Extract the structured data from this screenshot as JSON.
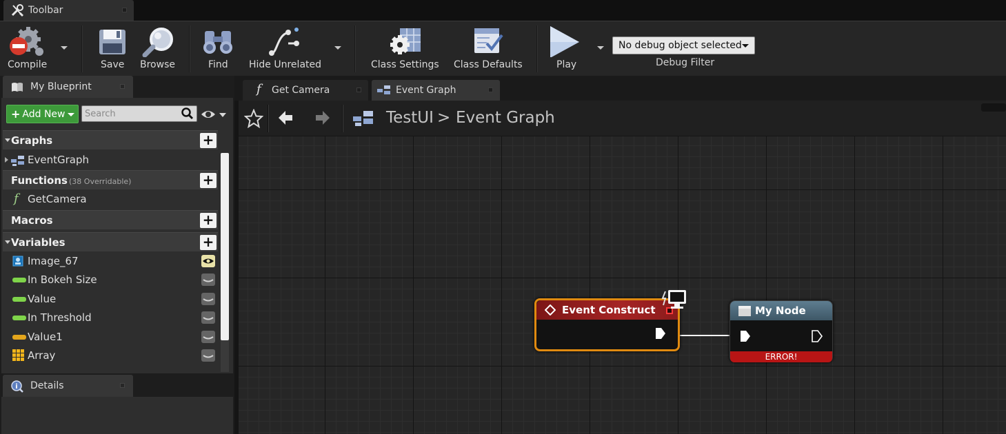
{
  "top_tab": {
    "label": "Toolbar"
  },
  "toolbar": {
    "compile_label": "Compile",
    "save_label": "Save",
    "browse_label": "Browse",
    "find_label": "Find",
    "hide_unrelated_label": "Hide Unrelated",
    "class_settings_label": "Class Settings",
    "class_defaults_label": "Class Defaults",
    "play_label": "Play",
    "debug_filter": {
      "selected": "No debug object selected",
      "label": "Debug Filter"
    }
  },
  "my_blueprint": {
    "tab_label": "My Blueprint",
    "add_new_label": "Add New",
    "search_placeholder": "Search",
    "categories": {
      "graphs": {
        "title": "Graphs",
        "items": [
          "EventGraph"
        ]
      },
      "functions": {
        "title": "Functions",
        "subtitle": "(38 Overridable)",
        "items": [
          "GetCamera"
        ]
      },
      "macros": {
        "title": "Macros"
      },
      "variables": {
        "title": "Variables",
        "items": [
          "Image_67",
          "In Bokeh Size",
          "Value",
          "In Threshold",
          "Value1",
          "Array"
        ]
      }
    }
  },
  "details": {
    "tab_label": "Details"
  },
  "graph_tabs": [
    {
      "label": "Get Camera",
      "active": false
    },
    {
      "label": "Event Graph",
      "active": true
    }
  ],
  "breadcrumb": {
    "root": "TestUI",
    "separator": ">",
    "leaf": "Event Graph"
  },
  "nodes": {
    "event_construct": {
      "title": "Event Construct"
    },
    "my_node": {
      "title": "My Node",
      "error": "ERROR!"
    }
  },
  "colors": {
    "event_header": "#8b1d1d",
    "node_header": "#4d6a7c",
    "error_bar": "#b81515",
    "selection_outline": "#e08a10",
    "add_new_green": "#3d9a3a",
    "panel_bg": "#2e2e2e",
    "graph_bg": "#262626"
  }
}
